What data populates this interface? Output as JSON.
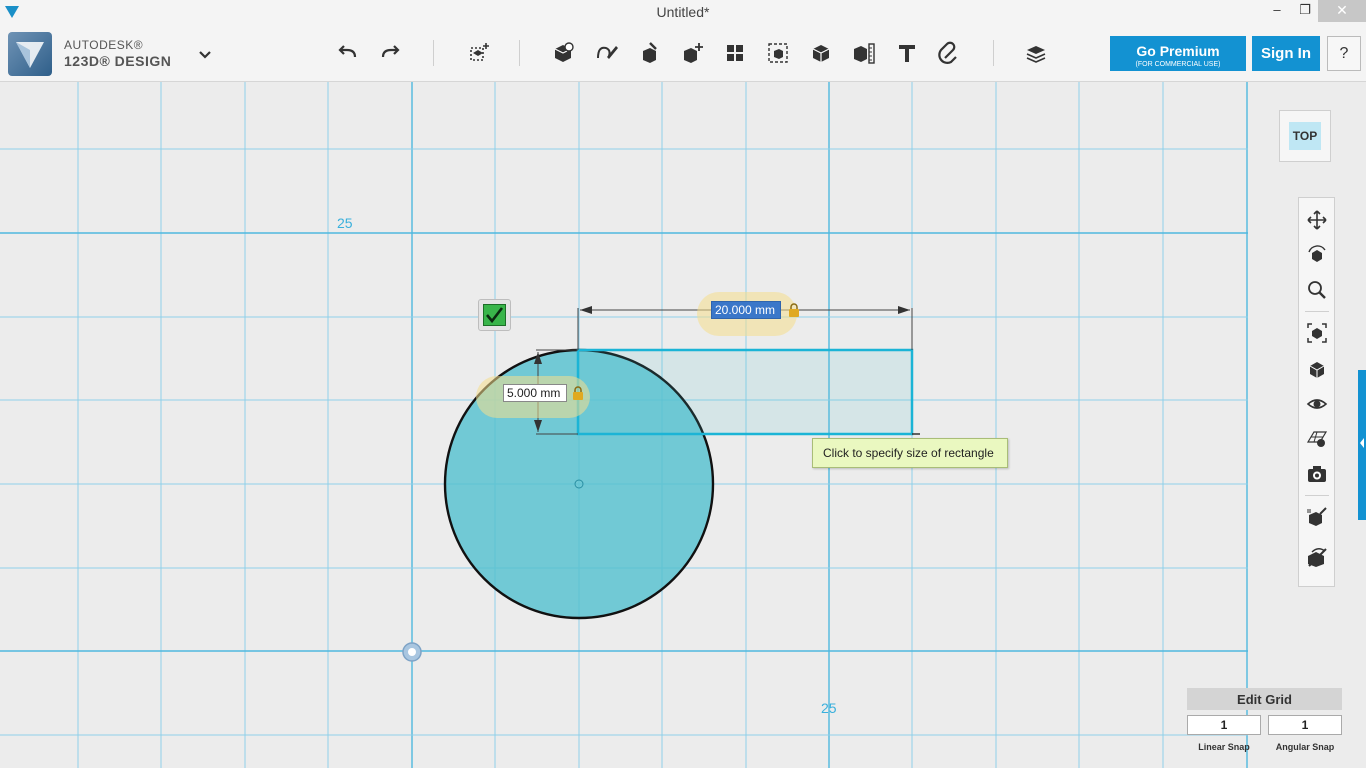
{
  "window": {
    "title": "Untitled*",
    "minimize_glyph": "–",
    "maximize_glyph": "❐",
    "close_glyph": "✕"
  },
  "brand": {
    "line1": "AUTODESK®",
    "line2": "123D® DESIGN"
  },
  "toolbar": {
    "tools": [
      {
        "id": "undo",
        "icon": "undo-icon"
      },
      {
        "id": "redo",
        "icon": "redo-icon"
      },
      {
        "id": "transform",
        "icon": "transform-icon"
      },
      {
        "id": "primitives",
        "icon": "primitives-icon"
      },
      {
        "id": "sketch",
        "icon": "sketch-icon"
      },
      {
        "id": "construct",
        "icon": "construct-icon"
      },
      {
        "id": "modify",
        "icon": "modify-icon"
      },
      {
        "id": "pattern",
        "icon": "pattern-icon"
      },
      {
        "id": "grouping",
        "icon": "grouping-icon"
      },
      {
        "id": "combine",
        "icon": "combine-icon"
      },
      {
        "id": "measure",
        "icon": "measure-icon"
      },
      {
        "id": "text",
        "icon": "text-icon"
      },
      {
        "id": "snap",
        "icon": "snap-icon"
      },
      {
        "id": "material",
        "icon": "material-icon"
      }
    ],
    "premium_label": "Go Premium",
    "premium_sub": "(FOR COMMERCIAL USE)",
    "signin_label": "Sign In",
    "help_label": "?"
  },
  "canvas": {
    "width_value": "20.000 mm",
    "height_value": "5.000 mm",
    "tooltip": "Click to specify size of rectangle",
    "grid_label_left": "25",
    "grid_label_bottom": "25",
    "sketch_fill": "#56c1d0",
    "sketch_line": "#1bb4d6",
    "grid_color": "#8fd0ea"
  },
  "viewcube": {
    "face_label": "TOP"
  },
  "navbar": {
    "items": [
      {
        "id": "pan",
        "icon": "pan-icon"
      },
      {
        "id": "orbit",
        "icon": "orbit-icon"
      },
      {
        "id": "zoom",
        "icon": "zoom-icon"
      },
      {
        "id": "fit",
        "icon": "fit-icon"
      },
      {
        "id": "perspective",
        "icon": "perspective-icon"
      },
      {
        "id": "visibility",
        "icon": "eye-icon"
      },
      {
        "id": "material-display",
        "icon": "material-display-icon"
      },
      {
        "id": "screenshot",
        "icon": "camera-icon"
      },
      {
        "id": "snap-settings",
        "icon": "snap-settings-icon"
      },
      {
        "id": "hide-all",
        "icon": "hide-icon"
      }
    ]
  },
  "editgrid": {
    "button_label": "Edit Grid",
    "linear_snap_value": "1",
    "angular_snap_value": "1",
    "linear_snap_label": "Linear Snap",
    "angular_snap_label": "Angular Snap"
  }
}
